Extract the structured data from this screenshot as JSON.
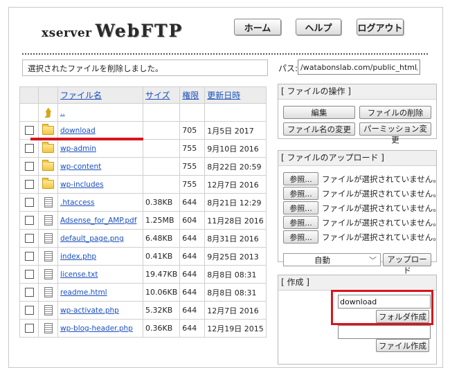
{
  "header": {
    "logo_small": "xserver",
    "logo_big": "WebFTP",
    "nav": [
      {
        "label": "ホーム"
      },
      {
        "label": "ヘルプ"
      },
      {
        "label": "ログアウト"
      }
    ]
  },
  "status_message": "選択されたファイルを削除しました。",
  "path": {
    "label": "パス:",
    "value": "/watabonslab.com/public_html/"
  },
  "file_table": {
    "columns": [
      "ファイル名",
      "サイズ",
      "権限",
      "更新日時"
    ],
    "rows": [
      {
        "name": "..",
        "size": "",
        "perm": "",
        "date": "",
        "icon": "up-arrow-icon",
        "checkbox": false
      },
      {
        "name": "download",
        "size": "",
        "perm": "705",
        "date": "1月5日 2017",
        "icon": "folder-icon",
        "checkbox": true
      },
      {
        "name": "wp-admin",
        "size": "",
        "perm": "755",
        "date": "9月10日 2016",
        "icon": "folder-icon",
        "checkbox": true
      },
      {
        "name": "wp-content",
        "size": "",
        "perm": "755",
        "date": "8月22日 20:59",
        "icon": "folder-icon",
        "checkbox": true
      },
      {
        "name": "wp-includes",
        "size": "",
        "perm": "755",
        "date": "12月7日 2016",
        "icon": "folder-icon",
        "checkbox": true
      },
      {
        "name": ".htaccess",
        "size": "0.38KB",
        "perm": "644",
        "date": "8月21日 12:29",
        "icon": "file-icon",
        "checkbox": true
      },
      {
        "name": "Adsense_for_AMP.pdf",
        "size": "1.25MB",
        "perm": "604",
        "date": "11月28日 2016",
        "icon": "file-icon",
        "checkbox": true
      },
      {
        "name": "default_page.png",
        "size": "6.48KB",
        "perm": "644",
        "date": "8月31日 2016",
        "icon": "file-icon",
        "checkbox": true
      },
      {
        "name": "index.php",
        "size": "0.41KB",
        "perm": "644",
        "date": "9月25日 2013",
        "icon": "file-icon",
        "checkbox": true
      },
      {
        "name": "license.txt",
        "size": "19.47KB",
        "perm": "644",
        "date": "8月8日 08:31",
        "icon": "file-icon",
        "checkbox": true
      },
      {
        "name": "readme.html",
        "size": "10.06KB",
        "perm": "644",
        "date": "8月8日 08:31",
        "icon": "file-icon",
        "checkbox": true
      },
      {
        "name": "wp-activate.php",
        "size": "5.32KB",
        "perm": "644",
        "date": "12月7日 2016",
        "icon": "file-icon",
        "checkbox": true
      },
      {
        "name": "wp-blog-header.php",
        "size": "0.36KB",
        "perm": "644",
        "date": "12月19日 2015",
        "icon": "file-icon",
        "checkbox": true
      }
    ]
  },
  "file_ops": {
    "title": "[ ファイルの操作 ]",
    "edit": "編集",
    "delete": "ファイルの削除",
    "rename": "ファイル名の変更",
    "chmod": "パーミッション変更"
  },
  "upload": {
    "title": "[ ファイルのアップロード ]",
    "browse_label": "参照...",
    "no_file": "ファイルが選択されていません。",
    "mode": "自動",
    "upload_button": "アップロード"
  },
  "create": {
    "title": "[ 作成 ]",
    "folder_name_value": "download",
    "folder_button": "フォルダ作成",
    "file_name_value": "",
    "file_button": "ファイル作成"
  },
  "colors": {
    "highlight": "#d9141b",
    "link": "#1a4fbf"
  }
}
